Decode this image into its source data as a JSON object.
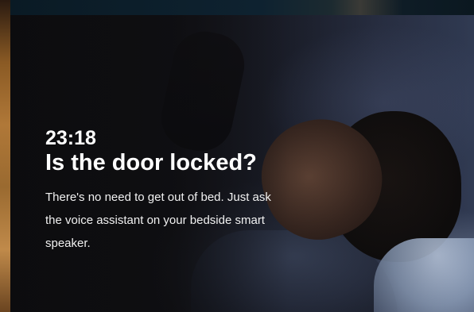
{
  "slide": {
    "time": "23:18",
    "headline": "Is the door locked?",
    "body": "There's no need to get out of bed. Just ask the voice assistant on your bedside smart speaker."
  },
  "colors": {
    "text": "#ffffff",
    "background": "#0f0f12"
  }
}
